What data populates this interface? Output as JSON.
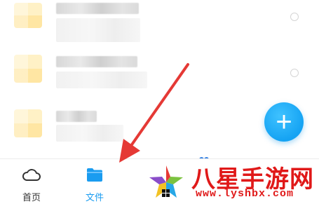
{
  "list": {
    "rows": [
      {
        "name": "",
        "meta": ""
      },
      {
        "name": "",
        "meta": ""
      },
      {
        "name": "",
        "meta": ""
      }
    ]
  },
  "fab": {
    "icon": "plus-icon",
    "symbol": "+"
  },
  "tabbar": {
    "tabs": [
      {
        "label": "首页",
        "icon": "cloud-icon",
        "active": false
      },
      {
        "label": "文件",
        "icon": "folder-icon",
        "active": true
      }
    ],
    "active_color": "#1a9cf0"
  },
  "watermark": {
    "title": "八星手游网",
    "url": "www.lyshbx.com"
  },
  "colors": {
    "accent": "#1a9cf0",
    "fab": "#15a3f3",
    "arrow": "#e53935",
    "folder": "#ffe6a3"
  }
}
